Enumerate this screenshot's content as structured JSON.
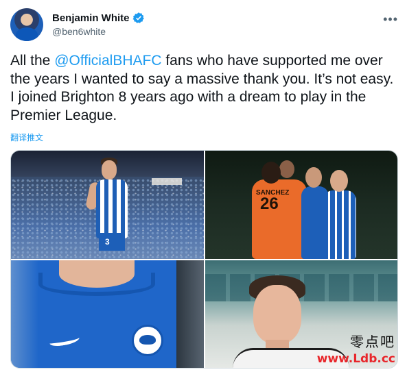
{
  "author": {
    "display_name": "Benjamin White",
    "handle": "@ben6white",
    "verified_icon": "verified-badge-icon",
    "accent_color": "#1d9bf0"
  },
  "tweet": {
    "text_before": "All the ",
    "mention": "@OfficialBHAFC",
    "text_after": " fans who have supported me over the years I wanted to say a massive thank you. It’s not easy. I joined Brighton 8 years ago with a dream to play in the Premier League.",
    "translate_link": "翻译推文"
  },
  "more_menu_icon": "more-dots-icon",
  "media": {
    "photos": [
      {
        "description_icon": "photo-player-applauding"
      },
      {
        "description_icon": "photo-players-hugging"
      },
      {
        "description_icon": "photo-shirt-crest-closeup"
      },
      {
        "description_icon": "photo-player-portrait"
      }
    ],
    "photo2_jersey_name": "SANCHEZ",
    "photo2_jersey_number": "26",
    "photo1_jersey_number": "3"
  },
  "watermark": {
    "chinese": "零点吧",
    "url": "www.Ldb.cc"
  }
}
